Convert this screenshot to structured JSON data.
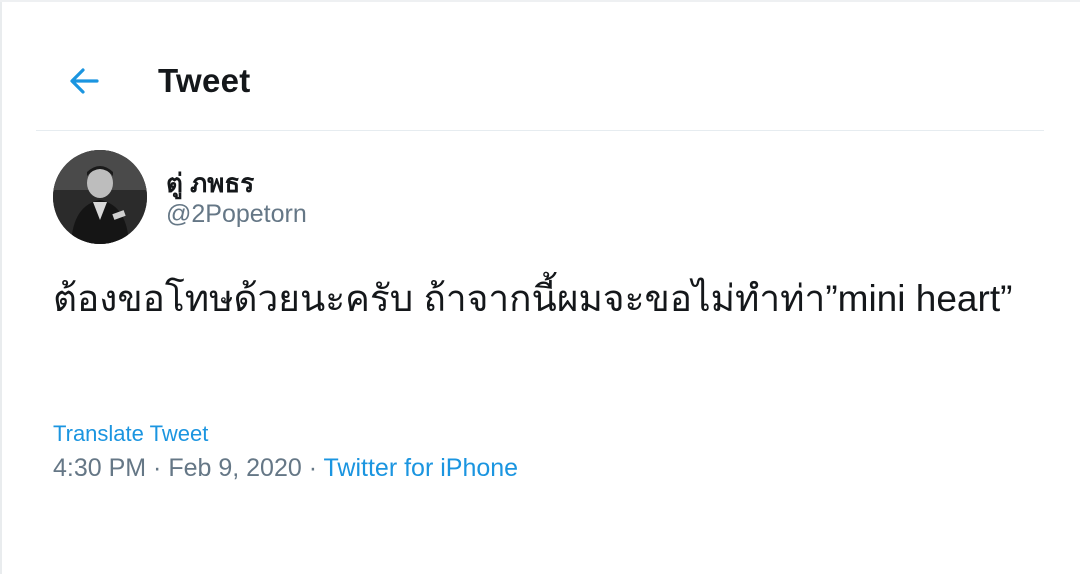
{
  "header": {
    "title": "Tweet",
    "back_icon": "arrow-left-icon"
  },
  "colors": {
    "accent": "#1b95e0",
    "text_primary": "#14171a",
    "text_secondary": "#657786",
    "divider": "#e6ecf0"
  },
  "tweet": {
    "author": {
      "display_name": "ตู่ ภพธร",
      "handle": "@2Popetorn",
      "avatar_icon": "avatar-photo"
    },
    "text": "ต้องขอโทษด้วยนะครับ ถ้าจากนี้ผมจะขอไม่ทำท่า”mini heart”",
    "translate_label": "Translate Tweet",
    "time": "4:30 PM",
    "separator": " · ",
    "date": "Feb 9, 2020",
    "source": "Twitter for iPhone"
  }
}
